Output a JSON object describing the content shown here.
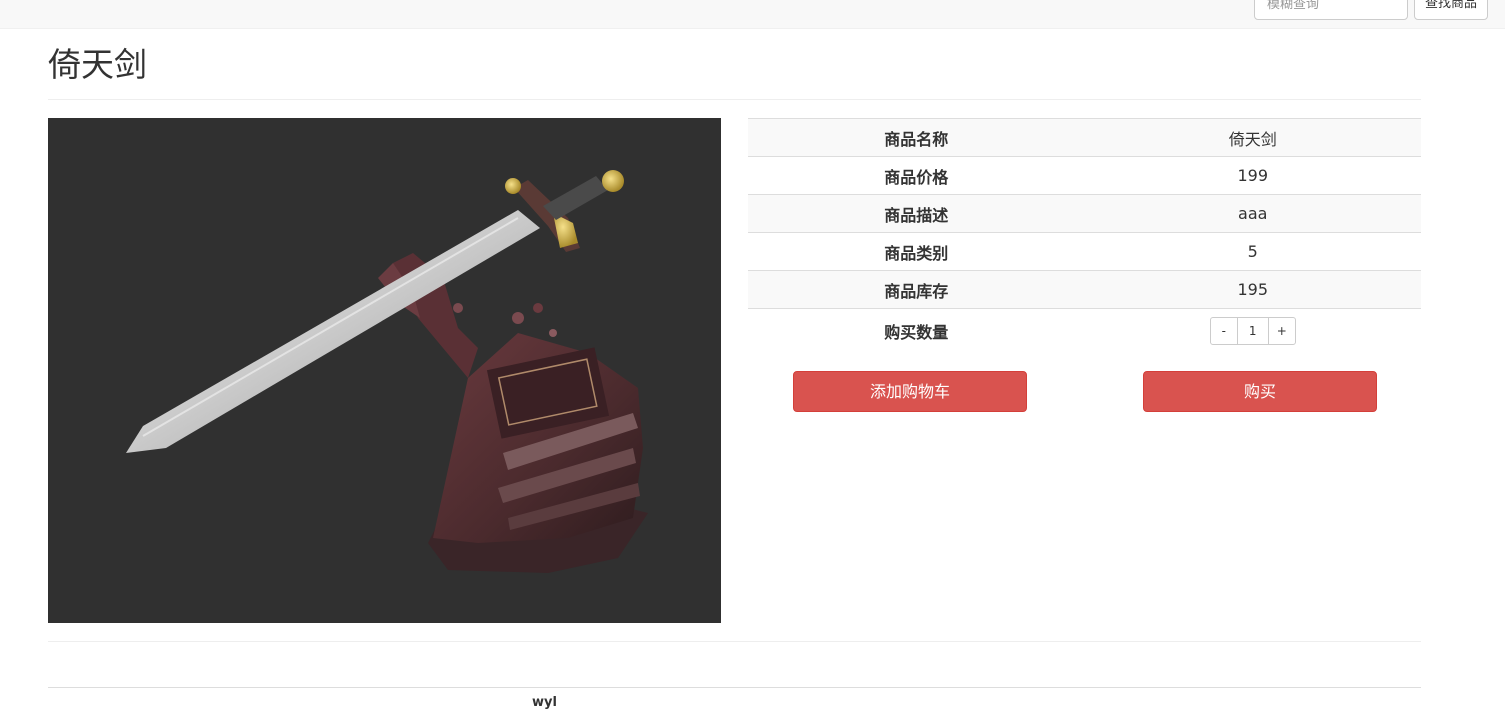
{
  "search": {
    "placeholder": "模糊查询",
    "button_label": "查找商品"
  },
  "page_title": "倚天剑",
  "product_image": {
    "alt": "倚天剑",
    "background_color": "#303030"
  },
  "details": [
    {
      "label": "商品名称",
      "value": "倚天剑"
    },
    {
      "label": "商品价格",
      "value": "199"
    },
    {
      "label": "商品描述",
      "value": "aaa"
    },
    {
      "label": "商品类别",
      "value": "5"
    },
    {
      "label": "商品库存",
      "value": "195"
    }
  ],
  "quantity": {
    "label": "购买数量",
    "minus": "-",
    "value": "1",
    "plus": "+"
  },
  "actions": {
    "add_to_cart": "添加购物车",
    "buy": "购买"
  },
  "colors": {
    "danger": "#d9534f",
    "topbar": "#f8f8f8",
    "stripe": "#f9f9f9"
  },
  "footer": {
    "author": "wyl"
  }
}
